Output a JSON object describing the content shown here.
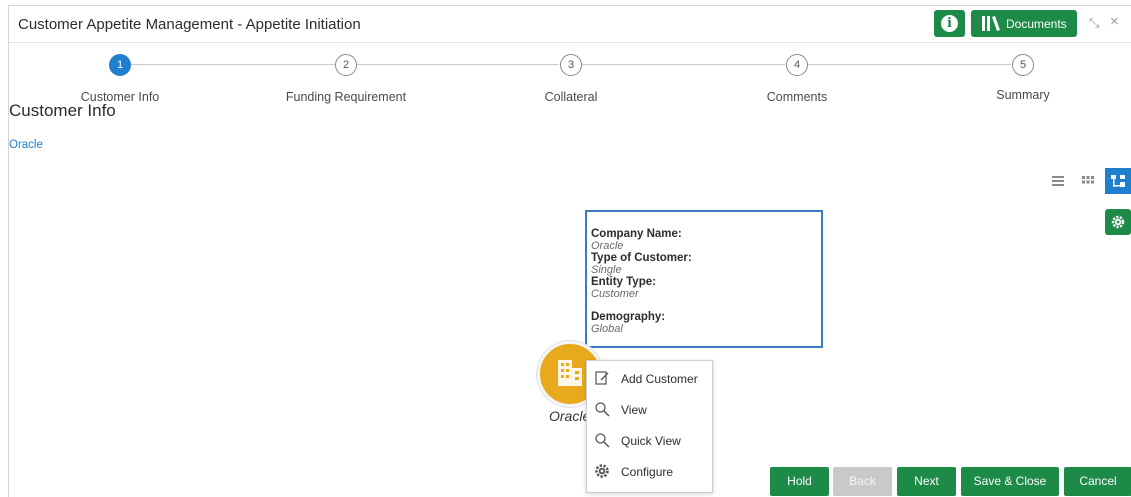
{
  "window": {
    "title": "Customer Appetite Management - Appetite Initiation",
    "info_icon": "i",
    "documents_label": "Documents",
    "minimize_glyph": "⤡",
    "close_glyph": "×"
  },
  "stepper": {
    "steps": [
      {
        "number": "1",
        "label": "Customer Info",
        "active": true
      },
      {
        "number": "2",
        "label": "Funding Requirement",
        "active": false
      },
      {
        "number": "3",
        "label": "Collateral",
        "active": false
      },
      {
        "number": "4",
        "label": "Comments",
        "active": false
      },
      {
        "number": "5",
        "label": "Summary",
        "active": false
      }
    ]
  },
  "main": {
    "section_title": "Customer Info",
    "crumb": "Oracle",
    "view_modes": [
      "list-view-icon",
      "grid-view-icon",
      "hierarchy-view-icon"
    ],
    "active_view": "hierarchy-view-icon"
  },
  "tooltip": {
    "company_name_label": "Company Name:",
    "company_name_value": "Oracle",
    "customer_type_label": "Type of Customer:",
    "customer_type_value": "Single",
    "entity_type_label": "Entity Type:",
    "entity_type_value": "Customer",
    "demography_label": "Demography:",
    "demography_value": "Global"
  },
  "node": {
    "label": "Oracle",
    "icon": "building-icon"
  },
  "context_menu": {
    "items": [
      {
        "label": "Add Customer",
        "icon": "edit-icon"
      },
      {
        "label": "View",
        "icon": "search-icon"
      },
      {
        "label": "Quick View",
        "icon": "search-icon"
      },
      {
        "label": "Configure",
        "icon": "gear-icon"
      }
    ]
  },
  "footer": {
    "hold": "Hold",
    "back": "Back",
    "next": "Next",
    "save_close": "Save & Close",
    "cancel": "Cancel"
  },
  "colors": {
    "brand_green": "#1d8a47",
    "accent_blue": "#1f7fce",
    "node_yellow": "#e9a91c",
    "disabled_gray": "#c9c9c9"
  }
}
